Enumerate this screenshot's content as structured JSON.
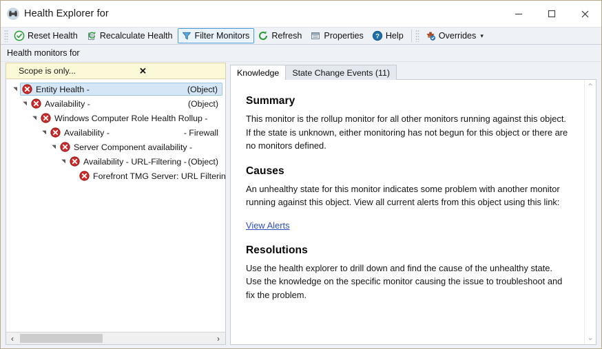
{
  "window": {
    "title": "Health Explorer for",
    "icon": "binoculars-icon",
    "minimize_label": "–",
    "maximize_label": "□",
    "close_label": "✕"
  },
  "toolbar": {
    "buttons": [
      {
        "label": "Reset Health",
        "icon": "reset-health-icon",
        "active": false
      },
      {
        "label": "Recalculate Health",
        "icon": "recalculate-health-icon",
        "active": false
      },
      {
        "label": "Filter Monitors",
        "icon": "filter-icon",
        "active": true
      },
      {
        "label": "Refresh",
        "icon": "refresh-icon",
        "active": false
      },
      {
        "label": "Properties",
        "icon": "properties-icon",
        "active": false
      },
      {
        "label": "Help",
        "icon": "help-icon",
        "active": false
      }
    ],
    "overrides": {
      "label": "Overrides",
      "icon": "overrides-icon",
      "caret": "▾"
    }
  },
  "subheader": {
    "text": "Health monitors for"
  },
  "left_pane": {
    "scope": {
      "text": "Scope is only...",
      "close_icon": "close-icon",
      "close_glyph": "✕"
    },
    "tree": [
      {
        "indent": 0,
        "expanded": true,
        "selected": true,
        "status": "critical-icon",
        "label": "Entity Health -",
        "trailing": "(Object)"
      },
      {
        "indent": 1,
        "expanded": true,
        "selected": false,
        "status": "critical-icon",
        "label": "Availability -",
        "trailing": "(Object)"
      },
      {
        "indent": 2,
        "expanded": true,
        "selected": false,
        "status": "critical-icon",
        "label": "Windows Computer Role Health Rollup -",
        "trailing": ""
      },
      {
        "indent": 3,
        "expanded": true,
        "selected": false,
        "status": "critical-icon",
        "label": "Availability -",
        "trailing": "- Firewall"
      },
      {
        "indent": 4,
        "expanded": true,
        "selected": false,
        "status": "critical-icon",
        "label": "Server Component availability -",
        "trailing": ""
      },
      {
        "indent": 5,
        "expanded": true,
        "selected": false,
        "status": "critical-icon",
        "label": "Availability - URL-Filtering -",
        "trailing": "(Object)"
      },
      {
        "indent": 6,
        "expanded": false,
        "selected": false,
        "status": "critical-icon",
        "label": "Forefront TMG Server: URL Filtering - Server",
        "trailing": ""
      }
    ],
    "hscroll": {
      "left_glyph": "‹",
      "right_glyph": "›"
    }
  },
  "right_pane": {
    "tabs": [
      {
        "label": "Knowledge",
        "selected": true
      },
      {
        "label": "State Change Events (11)",
        "selected": false
      }
    ],
    "knowledge": {
      "summary_heading": "Summary",
      "summary_text": "This monitor is the rollup monitor for all other monitors running against this object. If the state is unknown, either monitoring has not begun for this object or there are no monitors defined.",
      "causes_heading": "Causes",
      "causes_text": "An unhealthy state for this monitor indicates some problem with another monitor running against this object. View all current alerts from this object using this link:",
      "link_label": "View Alerts",
      "resolutions_heading": "Resolutions",
      "resolutions_text": "Use the health explorer to drill down and find the cause of the unhealthy state. Use the knowledge on the specific monitor causing the issue to troubleshoot and fix the problem."
    },
    "vscroll": {
      "up_glyph": "⌃",
      "down_glyph": "⌄"
    }
  },
  "colors": {
    "critical": "#d22a2a",
    "healthy": "#2e9e3e",
    "accent": "#3c97dd",
    "link": "#2f4fbf",
    "scope_bg": "#fcf9d8",
    "toolbar_bg": "#eef1f6",
    "selection_bg": "#d5e7f7"
  }
}
